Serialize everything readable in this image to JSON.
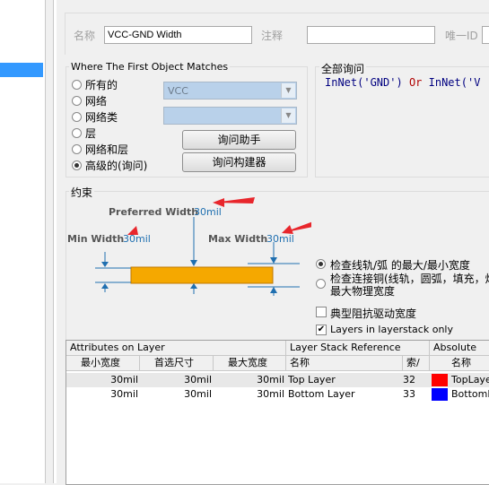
{
  "header": {
    "name_label": "名称",
    "name_value": "VCC-GND Width",
    "comment_label": "注释",
    "comment_value": "",
    "uid_label": "唯一ID"
  },
  "match": {
    "group_title": "Where The First Object Matches",
    "options": [
      "所有的",
      "网络",
      "网络类",
      "层",
      "网络和层",
      "高级的(询问)"
    ],
    "selected_index": 5,
    "net_combo_value": "VCC",
    "netclass_combo_value": "",
    "query_helper_button": "询问助手",
    "query_builder_button": "询问构建器"
  },
  "full_query": {
    "title": "全部询问",
    "part1": "InNet('GND')",
    "operator": "Or",
    "part2": "InNet('V"
  },
  "constraints": {
    "title": "约束",
    "preferred_label": "Preferred Width",
    "preferred_value": "30mil",
    "min_label": "Min Width",
    "min_value": "30mil",
    "max_label": "Max Width",
    "max_value": "30mil",
    "radio1": "检查线轨/弧 的最大/最小宽度",
    "radio2_line1": "检查连接铜(线轨，圆弧，填充，焊",
    "radio2_line2": "最大物理宽度",
    "check_impedance": "典型阻抗驱动宽度",
    "check_layers": "Layers in layerstack only",
    "check_layers_checked": true,
    "check_impedance_checked": false
  },
  "table": {
    "group1": "Attributes on Layer",
    "group2": "Layer Stack Reference",
    "group3": "Absolute Laye",
    "columns": [
      "最小宽度",
      "首选尺寸",
      "最大宽度",
      "名称",
      "索/",
      "名称"
    ],
    "rows": [
      {
        "min": "30mil",
        "pref": "30mil",
        "max": "30mil",
        "layer": "Top Layer",
        "index": "32",
        "color": "#ff0000",
        "abs": "TopLayer"
      },
      {
        "min": "30mil",
        "pref": "30mil",
        "max": "30mil",
        "layer": "Bottom Layer",
        "index": "33",
        "color": "#0000ff",
        "abs": "BottomLa"
      }
    ]
  },
  "colors": {
    "trace": "#f5a800",
    "arrow": "#e8262c",
    "accent": "#1f6fb0"
  }
}
